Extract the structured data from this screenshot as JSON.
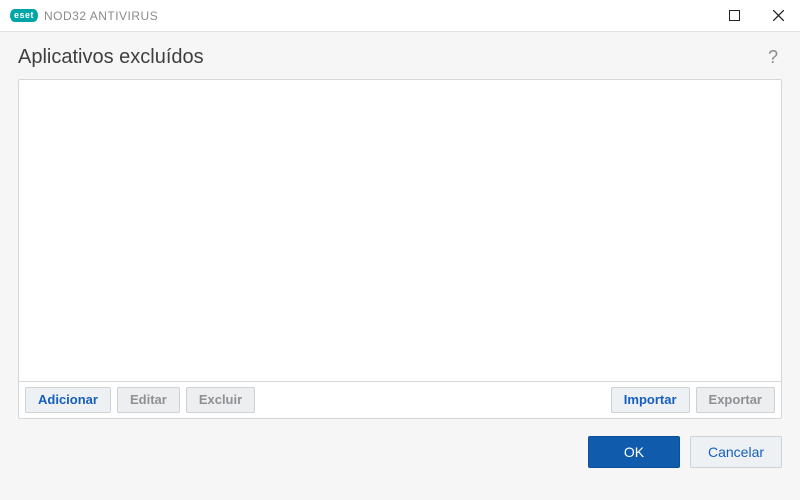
{
  "titlebar": {
    "logo_text": "eset",
    "product_name": "NOD32 ANTIVIRUS"
  },
  "header": {
    "title": "Aplicativos excluídos",
    "help_symbol": "?"
  },
  "list": {
    "items": []
  },
  "toolbar": {
    "add": "Adicionar",
    "edit": "Editar",
    "delete": "Excluir",
    "import": "Importar",
    "export": "Exportar"
  },
  "footer": {
    "ok": "OK",
    "cancel": "Cancelar"
  }
}
